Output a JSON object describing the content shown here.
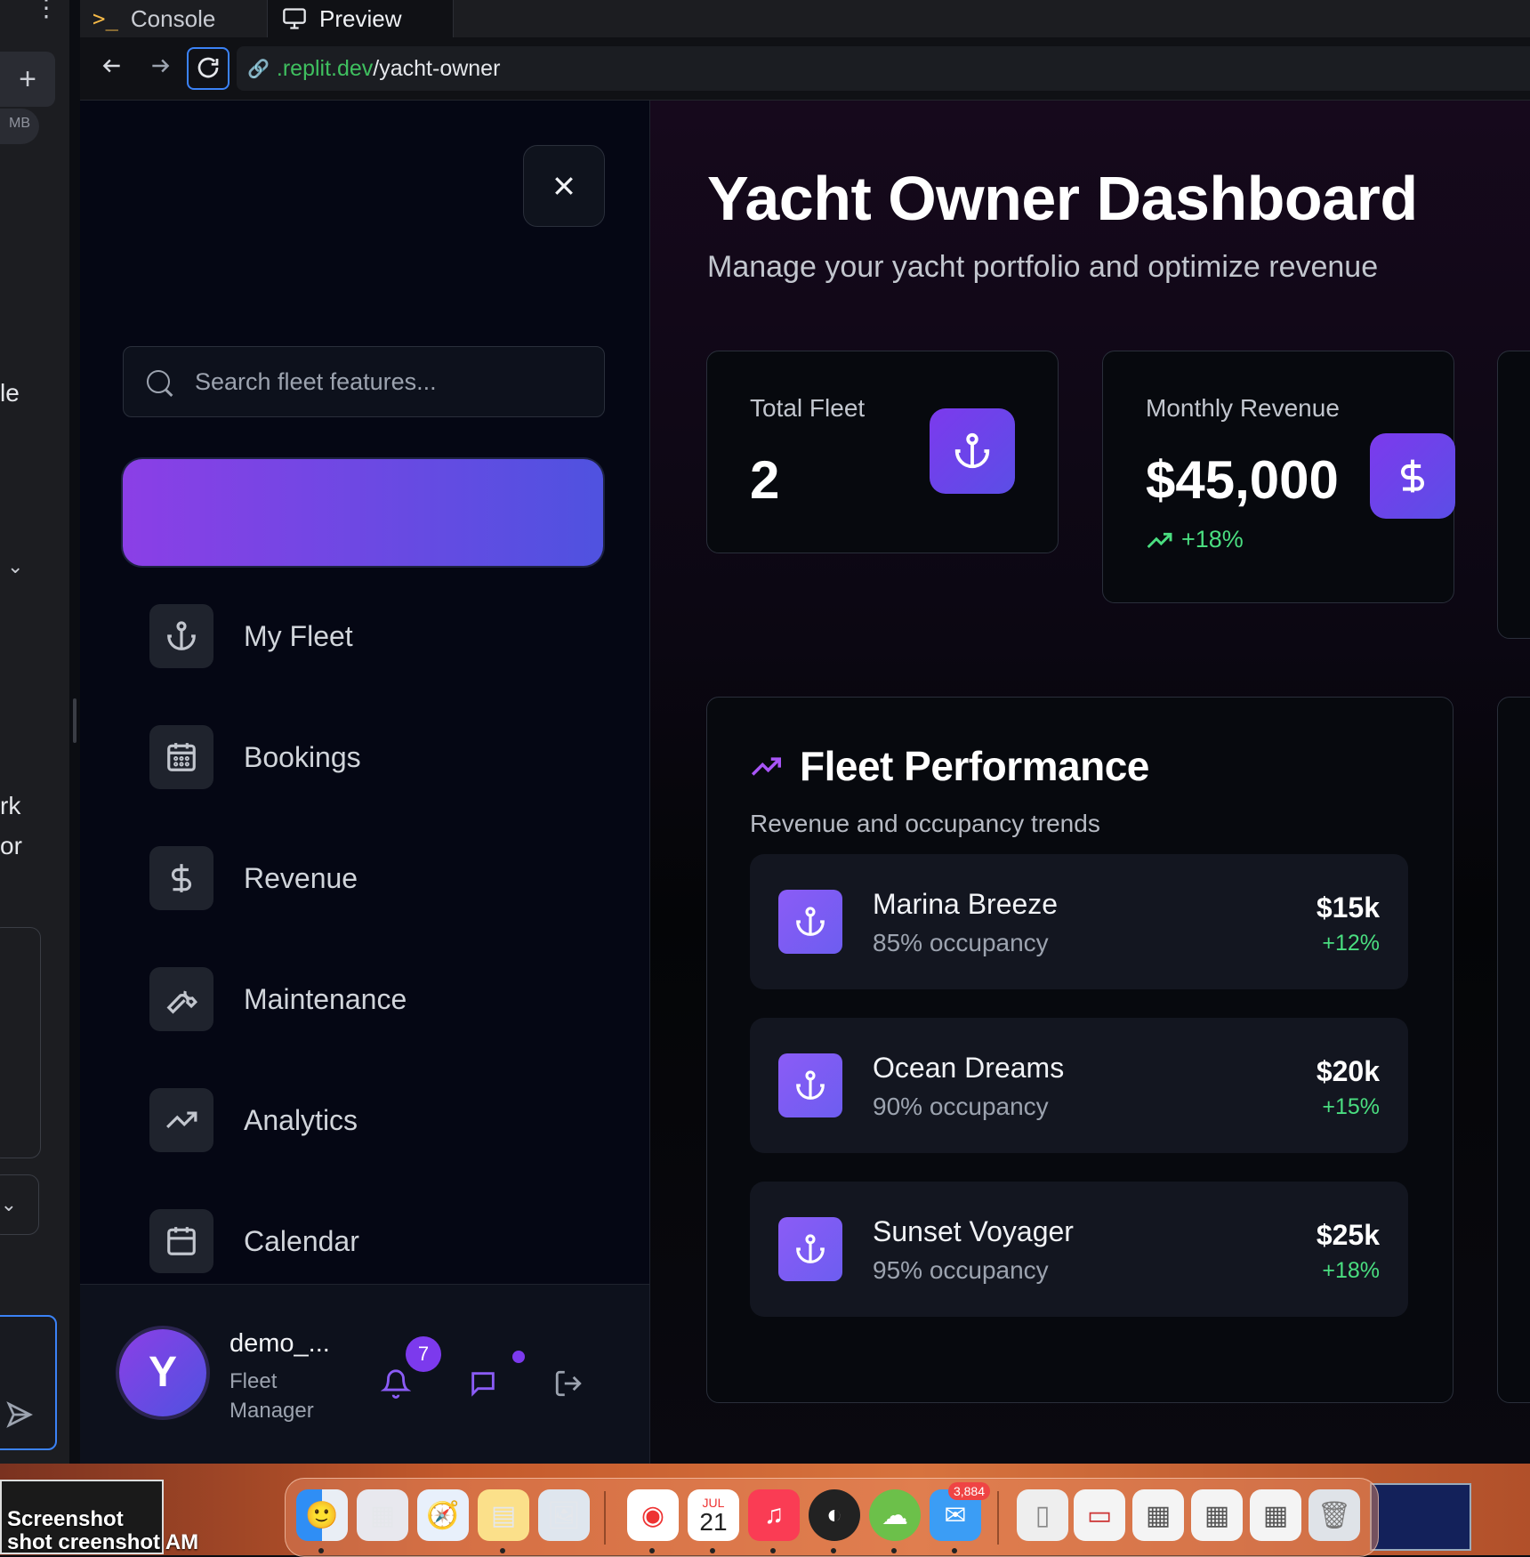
{
  "workspace": {
    "avatar_initials": "MB",
    "fragments": [
      "le",
      "rk",
      "or"
    ]
  },
  "browser": {
    "tabs": [
      {
        "label": "Console",
        "icon": "terminal-icon"
      },
      {
        "label": "Preview",
        "icon": "monitor-icon"
      }
    ],
    "url": {
      "domain": ".replit.dev",
      "path": "/yacht-owner"
    }
  },
  "sidebar": {
    "search_placeholder": "Search fleet features...",
    "nav_items": [
      {
        "label": "My Fleet",
        "icon": "anchor-icon"
      },
      {
        "label": "Bookings",
        "icon": "calendar-grid-icon"
      },
      {
        "label": "Revenue",
        "icon": "dollar-icon"
      },
      {
        "label": "Maintenance",
        "icon": "wrench-icon"
      },
      {
        "label": "Analytics",
        "icon": "trending-up-icon"
      },
      {
        "label": "Calendar",
        "icon": "calendar-icon"
      }
    ],
    "user": {
      "initial": "Y",
      "name": "demo_...",
      "role": "Fleet Manager",
      "notification_count": "7"
    }
  },
  "main": {
    "title": "Yacht Owner Dashboard",
    "subtitle": "Manage your yacht portfolio and optimize revenue",
    "stats": [
      {
        "label": "Total Fleet",
        "value": "2",
        "icon": "anchor-icon"
      },
      {
        "label": "Monthly Revenue",
        "value": "$45,000",
        "trend": "+18%",
        "icon": "dollar-icon"
      }
    ],
    "performance": {
      "title": "Fleet Performance",
      "subtitle": "Revenue and occupancy trends",
      "yachts": [
        {
          "name": "Marina Breeze",
          "occupancy": "85% occupancy",
          "revenue": "$15k",
          "growth": "+12%"
        },
        {
          "name": "Ocean Dreams",
          "occupancy": "90% occupancy",
          "revenue": "$20k",
          "growth": "+15%"
        },
        {
          "name": "Sunset Voyager",
          "occupancy": "95% occupancy",
          "revenue": "$25k",
          "growth": "+18%"
        }
      ]
    }
  },
  "dock": {
    "desktop_label": "Screenshot",
    "desktop_label_2": "shot",
    "desktop_label_3": "creenshot",
    "desktop_time": "AM",
    "calendar_month": "JUL",
    "calendar_day": "21",
    "mail_badge": "3,884",
    "apps": [
      "finder-icon",
      "launchpad-icon",
      "safari-icon",
      "notes-icon",
      "preview-icon",
      "chrome-icon",
      "calendar-app-icon",
      "music-icon",
      "app-icon",
      "cloud-icon",
      "mail-icon",
      "document-icon",
      "folder-icon",
      "folder-icon",
      "folder-icon",
      "folder-icon",
      "trash-icon"
    ]
  },
  "colors": {
    "accent_purple": "#7c3aed",
    "accent_indigo": "#4f52e0",
    "positive": "#4ade80",
    "url_green": "#3fbf5f",
    "focus_blue": "#3b82f6"
  }
}
